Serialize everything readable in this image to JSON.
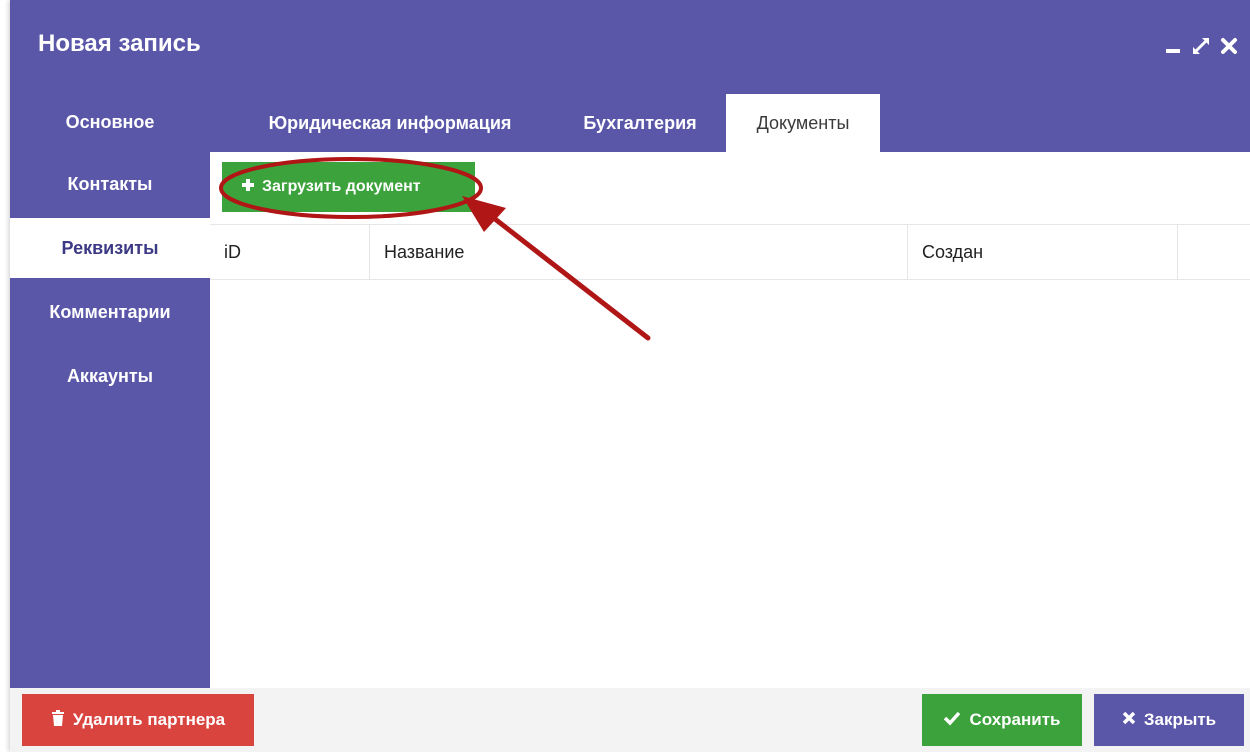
{
  "window": {
    "title": "Новая запись",
    "controls": [
      "minimize-icon",
      "maximize-icon",
      "close-icon"
    ]
  },
  "sidebar": {
    "items": [
      {
        "label": "Основное",
        "active": false
      },
      {
        "label": "Контакты",
        "active": false
      },
      {
        "label": "Реквизиты",
        "active": true
      },
      {
        "label": "Комментарии",
        "active": false
      },
      {
        "label": "Аккаунты",
        "active": false
      }
    ]
  },
  "tabs": [
    {
      "label": "Юридическая информация",
      "active": false
    },
    {
      "label": "Бухгалтерия",
      "active": false
    },
    {
      "label": "Документы",
      "active": true
    }
  ],
  "toolbar": {
    "upload_label": "Загрузить документ",
    "upload_icon": "plus-icon"
  },
  "grid": {
    "columns": [
      "iD",
      "Название",
      "Создан",
      ""
    ],
    "rows": []
  },
  "footer": {
    "delete_label": "Удалить партнера",
    "delete_icon": "trash-icon",
    "save_label": "Сохранить",
    "save_icon": "check-icon",
    "close_label": "Закрыть",
    "close_icon": "close-icon"
  },
  "colors": {
    "primary": "#5a56a8",
    "success": "#3ca23c",
    "danger": "#d9443f",
    "annotation": "#b01616"
  }
}
